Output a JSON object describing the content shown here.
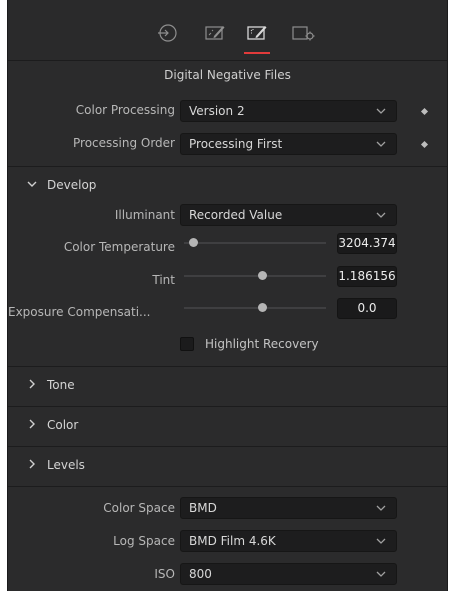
{
  "toolbar": {
    "tabs": [
      {
        "icon": "input-icon"
      },
      {
        "icon": "edit-icon"
      },
      {
        "icon": "magic-edit-icon",
        "active": true
      },
      {
        "icon": "settings-icon"
      }
    ]
  },
  "header": {
    "title": "Digital Negative Files"
  },
  "fields": {
    "color_processing": {
      "label": "Color Processing",
      "value": "Version 2"
    },
    "processing_order": {
      "label": "Processing Order",
      "value": "Processing First"
    }
  },
  "develop": {
    "title": "Develop",
    "illuminant": {
      "label": "Illuminant",
      "value": "Recorded Value"
    },
    "color_temperature": {
      "label": "Color Temperature",
      "value": "3204.374",
      "slider_fraction": 0.06
    },
    "tint": {
      "label": "Tint",
      "value": "1.186156",
      "slider_fraction": 0.55
    },
    "exposure": {
      "label": "Exposure Compensati...",
      "value": "0.0",
      "slider_fraction": 0.55
    },
    "highlight_recovery": {
      "label": "Highlight Recovery",
      "checked": false
    }
  },
  "sections": {
    "tone": "Tone",
    "color": "Color",
    "levels": "Levels"
  },
  "levels": {
    "color_space": {
      "label": "Color Space",
      "value": "BMD"
    },
    "log_space": {
      "label": "Log Space",
      "value": "BMD Film 4.6K"
    },
    "iso": {
      "label": "ISO",
      "value": "800"
    }
  },
  "colors": {
    "panel": "#2b2b2c",
    "field": "#1d1d1e",
    "accent": "#e23b3b"
  }
}
